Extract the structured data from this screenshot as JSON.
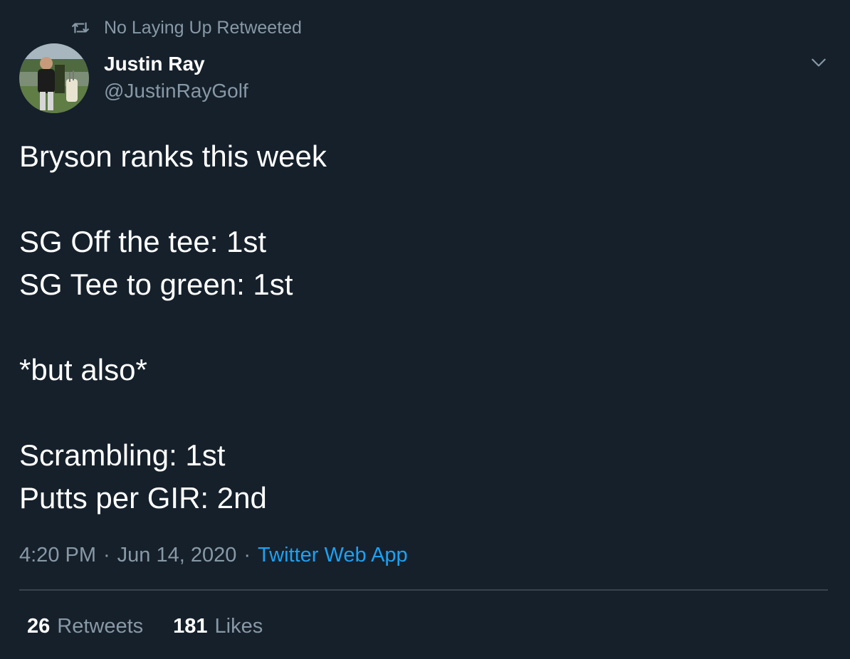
{
  "colors": {
    "background": "#15202b",
    "text_primary": "#ffffff",
    "text_secondary": "#8899a6",
    "link": "#1da1f2",
    "divider": "#38444d"
  },
  "social_context": {
    "icon": "retweet-icon",
    "text": "No Laying Up Retweeted"
  },
  "author": {
    "avatar": "avatar-photo",
    "name": "Justin Ray",
    "handle": "@JustinRayGolf"
  },
  "menu": {
    "icon": "chevron-down-icon"
  },
  "tweet": {
    "lines": [
      "Bryson ranks this week",
      "",
      "SG Off the tee: 1st",
      "SG Tee to green: 1st",
      "",
      "*but also*",
      "",
      "Scrambling: 1st",
      "Putts per GIR: 2nd"
    ]
  },
  "meta": {
    "time": "4:20 PM",
    "separator": "·",
    "date": "Jun 14, 2020",
    "source": "Twitter Web App"
  },
  "stats": {
    "retweets_count": "26",
    "retweets_label": "Retweets",
    "likes_count": "181",
    "likes_label": "Likes"
  }
}
